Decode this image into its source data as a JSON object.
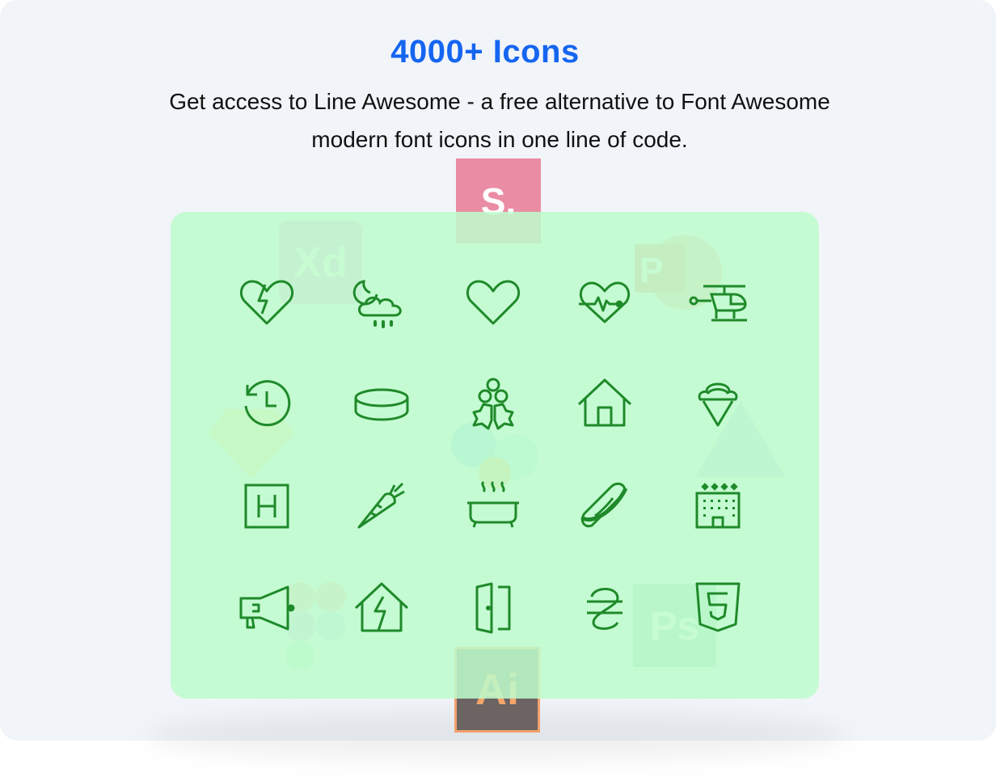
{
  "header": {
    "title": "4000+ Icons",
    "line1": "Get access to Line Awesome  - a free alternative to Font Awesome",
    "line2": "modern font icons in one line of code."
  },
  "brand_logos": {
    "sketch": "S.",
    "xd": "Xd",
    "powerpoint": "P",
    "photoshop": "Ps",
    "illustrator": "Ai"
  },
  "colors": {
    "accent": "#1565f0",
    "icon_green": "#1f8a2a",
    "panel_green": "#c5fbd3",
    "background": "#f1f4f9"
  },
  "icon_grid": [
    [
      "heart-broken-icon",
      "cloud-moon-rain-icon",
      "heart-icon",
      "heartbeat-icon",
      "helicopter-icon"
    ],
    [
      "history-icon",
      "hockey-puck-icon",
      "holly-berry-icon",
      "home-icon",
      "ice-cream-icon"
    ],
    [
      "hospital-symbol-icon",
      "carrot-icon",
      "hot-tub-icon",
      "hotdog-icon",
      "hotel-icon"
    ],
    [
      "bullhorn-icon",
      "house-damage-icon",
      "door-open-icon",
      "hryvnia-icon",
      "html5-icon"
    ]
  ]
}
